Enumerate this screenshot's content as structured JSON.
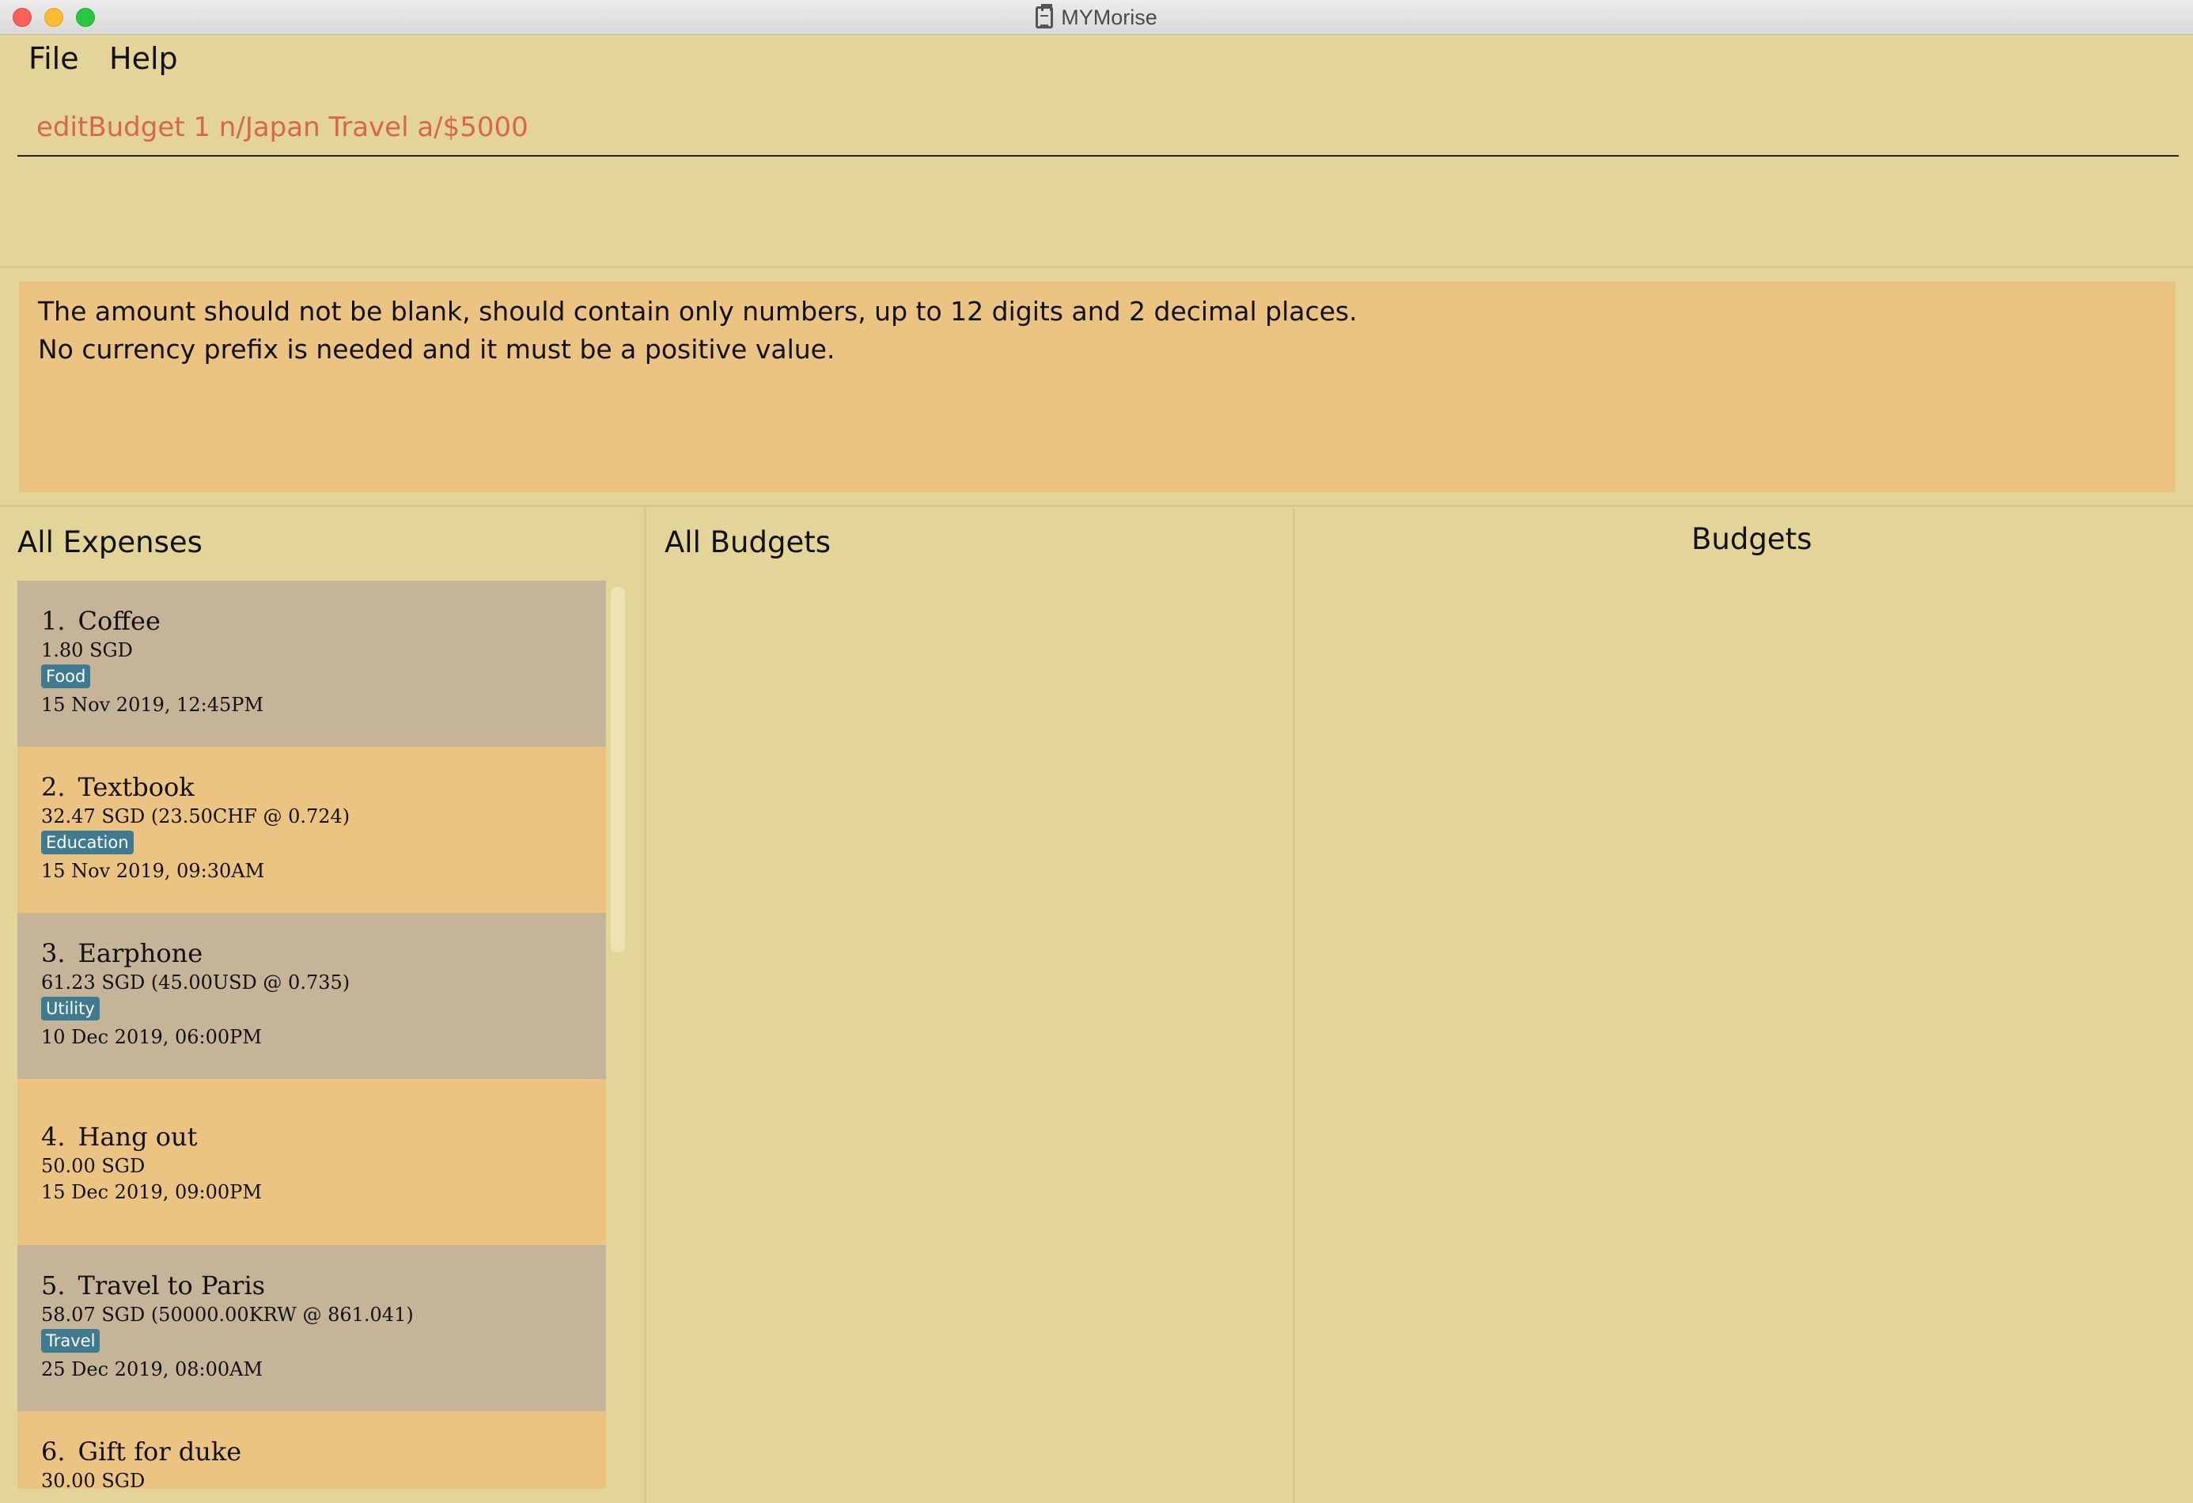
{
  "window": {
    "title": "MYMorise"
  },
  "menu": {
    "file": "File",
    "help": "Help"
  },
  "command": {
    "value": "editBudget 1 n/Japan Travel a/$5000"
  },
  "result": {
    "line1": "The amount should not be blank,  should contain only numbers, up to 12 digits and 2 decimal places.",
    "line2": "No currency prefix is needed and it must be a positive value."
  },
  "panels": {
    "expenses_title": "All Expenses",
    "budgets_title": "All Budgets",
    "budget_detail_title": "Budgets"
  },
  "expenses": [
    {
      "index": "1.",
      "name": "Coffee",
      "amount": "1.80 SGD",
      "tag": "Food",
      "date": "15 Nov 2019, 12:45PM"
    },
    {
      "index": "2.",
      "name": "Textbook",
      "amount": "32.47 SGD (23.50CHF @ 0.724)",
      "tag": "Education",
      "date": "15 Nov 2019, 09:30AM"
    },
    {
      "index": "3.",
      "name": "Earphone",
      "amount": "61.23 SGD (45.00USD @ 0.735)",
      "tag": "Utility",
      "date": "10 Dec 2019, 06:00PM"
    },
    {
      "index": "4.",
      "name": "Hang out",
      "amount": "50.00 SGD",
      "date": "15 Dec 2019, 09:00PM"
    },
    {
      "index": "5.",
      "name": "Travel to Paris",
      "amount": "58.07 SGD (50000.00KRW @ 861.041)",
      "tag": "Travel",
      "date": "25 Dec 2019, 08:00AM"
    },
    {
      "index": "6.",
      "name": "Gift for duke",
      "amount": "30.00 SGD"
    }
  ]
}
